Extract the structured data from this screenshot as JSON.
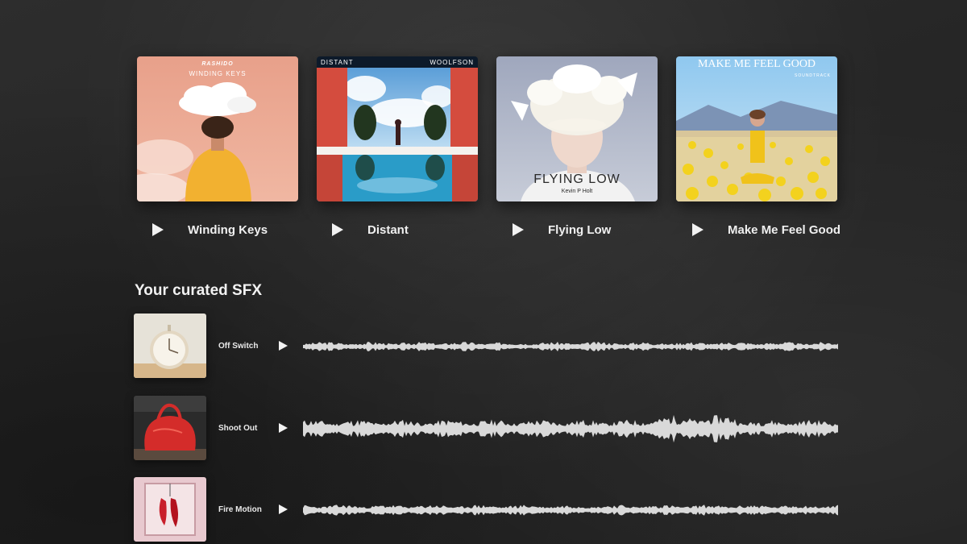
{
  "albums": [
    {
      "title": "Winding Keys",
      "cover_artist": "RASHIDO",
      "cover_title": "WINDING KEYS"
    },
    {
      "title": "Distant",
      "cover_left": "DISTANT",
      "cover_right": "WOOLFSON"
    },
    {
      "title": "Flying Low",
      "cover_title": "FLYING LOW",
      "cover_artist": "Kevin P Holt"
    },
    {
      "title": "Make Me Feel Good",
      "cover_title": "MAKE ME FEEL GOOD",
      "cover_sub": "SOUNDTRACK"
    }
  ],
  "sfx": {
    "section_title": "Your curated SFX",
    "items": [
      {
        "name": "Off Switch",
        "thumb_icon": "wall-clock-icon"
      },
      {
        "name": "Shoot Out",
        "thumb_icon": "red-bag-icon"
      },
      {
        "name": "Fire Motion",
        "thumb_icon": "hanging-peppers-icon"
      }
    ]
  },
  "colors": {
    "background": "#262626",
    "text": "#f2f2f2",
    "waveform": "#d9d9d9"
  }
}
